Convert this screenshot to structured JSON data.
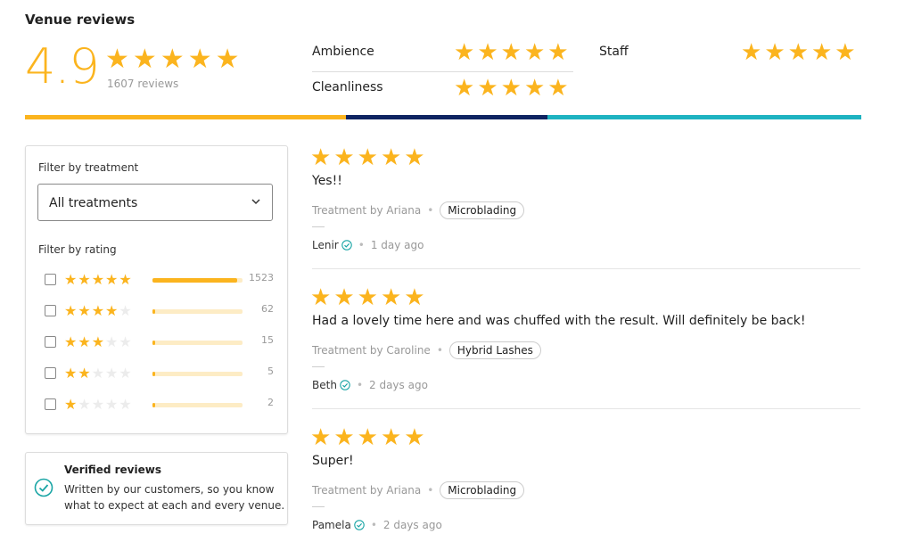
{
  "header": {
    "title": "Venue reviews",
    "rating": "4.9",
    "review_count": "1607 reviews"
  },
  "categories": {
    "ambience": "Ambience",
    "cleanliness": "Cleanliness",
    "staff": "Staff"
  },
  "colors": {
    "star": "#fbb41e",
    "bar_yellow": "#fbb41e",
    "bar_navy": "#0f2461",
    "bar_teal": "#1eb3c1",
    "verified": "#1aa5a5"
  },
  "filters": {
    "treatment_label": "Filter by treatment",
    "treatment_value": "All treatments",
    "rating_label": "Filter by rating",
    "ratings": [
      {
        "stars": 5,
        "count": "1523",
        "fraction": 0.94
      },
      {
        "stars": 4,
        "count": "62",
        "fraction": 0.02
      },
      {
        "stars": 3,
        "count": "15",
        "fraction": 0.01
      },
      {
        "stars": 2,
        "count": "5",
        "fraction": 0.01
      },
      {
        "stars": 1,
        "count": "2",
        "fraction": 0.01
      }
    ]
  },
  "verified": {
    "title": "Verified reviews",
    "line1": "Written by our customers, so you know",
    "line2": "what to expect at each and every venue."
  },
  "reviews": [
    {
      "rating": 5,
      "text": "Yes!!",
      "treatment_by": "Treatment by Ariana",
      "treatment": "Microblading",
      "author": "Lenir",
      "time": "1 day ago"
    },
    {
      "rating": 5,
      "text": "Had a lovely time here and was chuffed with the result. Will definitely be back!",
      "treatment_by": "Treatment by Caroline",
      "treatment": "Hybrid Lashes",
      "author": "Beth",
      "time": "2 days ago"
    },
    {
      "rating": 5,
      "text": "Super!",
      "treatment_by": "Treatment by Ariana",
      "treatment": "Microblading",
      "author": "Pamela",
      "time": "2 days ago"
    }
  ]
}
